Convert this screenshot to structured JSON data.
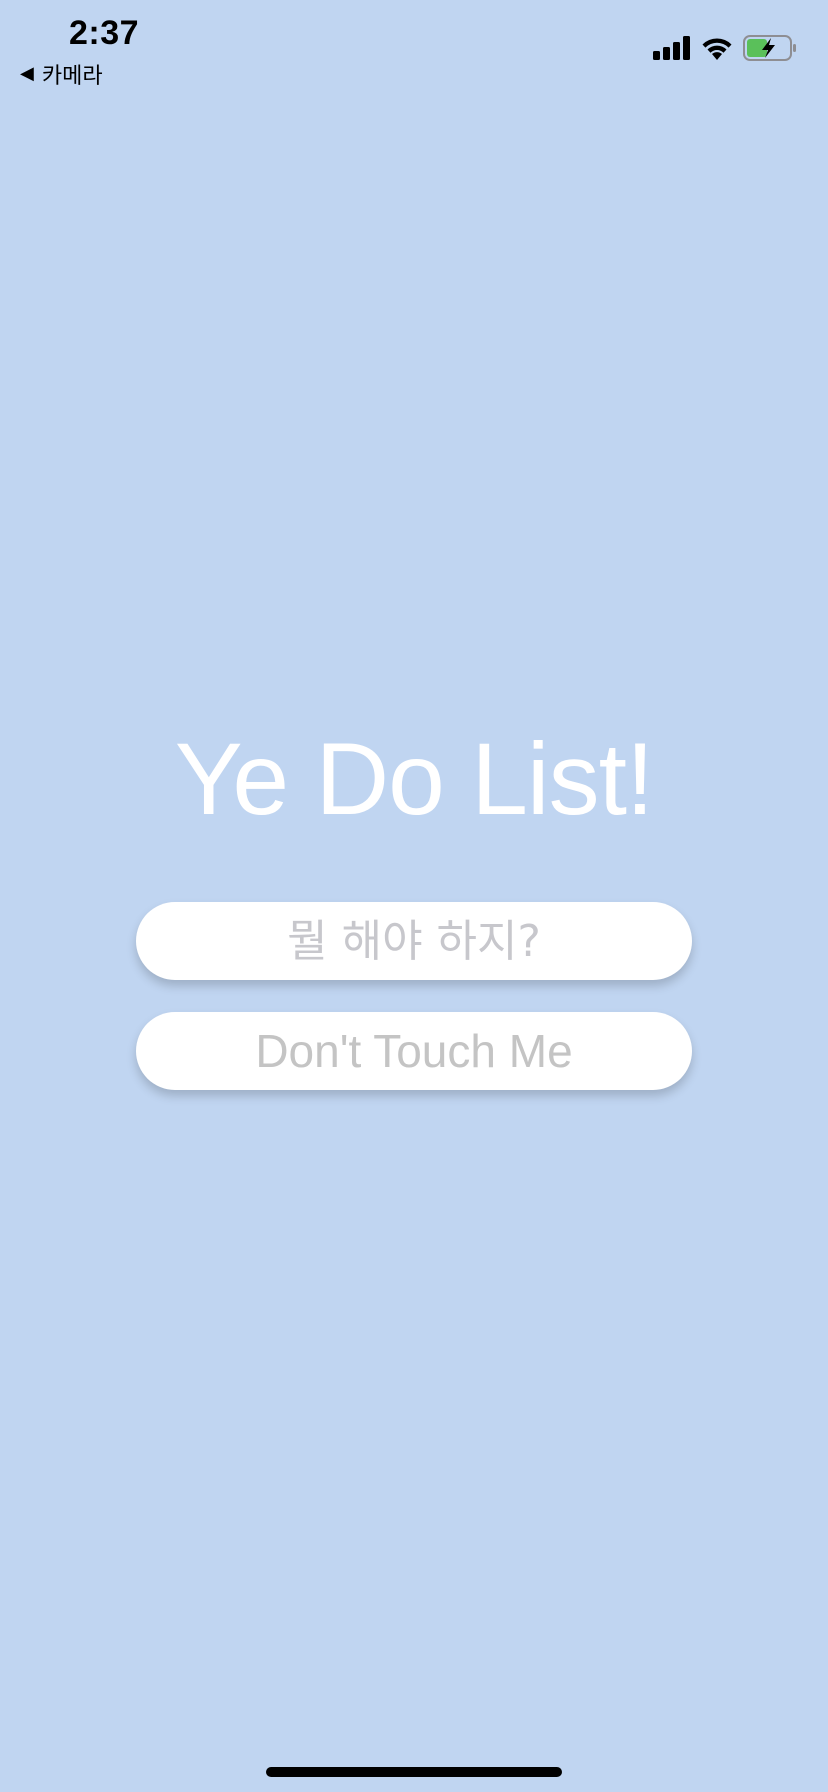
{
  "status_bar": {
    "time": "2:37",
    "back_label": "카메라",
    "back_arrow": "◀",
    "icons": [
      "cellular-signal-icon",
      "wifi-icon",
      "battery-charging-icon"
    ],
    "battery_color": "#5ac05a"
  },
  "main": {
    "title": "Ye Do List!",
    "todo_input": {
      "placeholder": "뭘 해야 하지?",
      "value": ""
    },
    "button_label": "Don't Touch Me"
  },
  "colors": {
    "background": "#c0d5f1",
    "title": "#ffffff",
    "placeholder": "#c7c7cc"
  }
}
